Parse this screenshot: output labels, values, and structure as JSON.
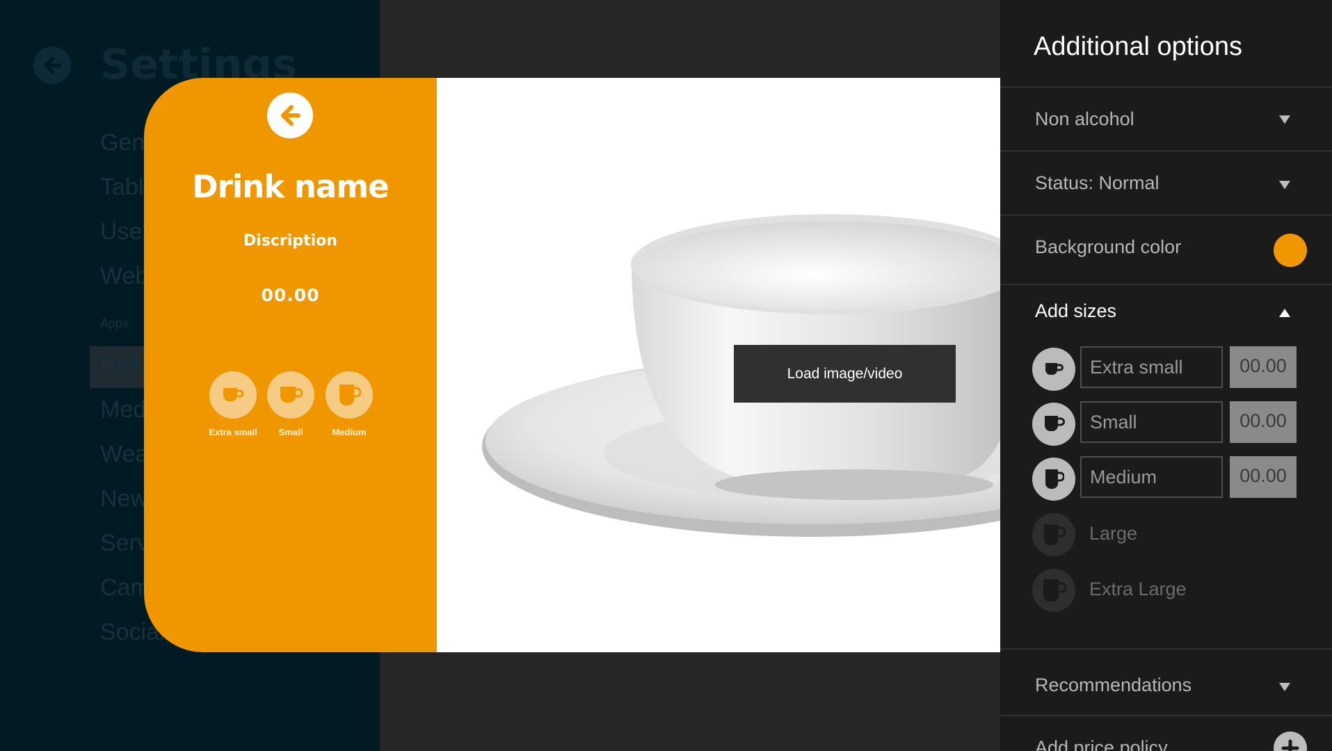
{
  "background": {
    "title": "Settings",
    "items": [
      "General",
      "Tables",
      "Users",
      "Web",
      "Restaurant",
      "Media",
      "Weather",
      "News",
      "Services",
      "Camera",
      "Social"
    ],
    "sub_label": "Apps",
    "active_item": "Restaurant"
  },
  "card": {
    "drink_name": "Drink name",
    "description": "Discription",
    "price": "00.00",
    "sizes": [
      {
        "label": "Extra small",
        "icon": "cup-extra-small-icon"
      },
      {
        "label": "Small",
        "icon": "cup-small-icon"
      },
      {
        "label": "Medium",
        "icon": "cup-medium-icon"
      }
    ],
    "load_button": "Load image/video",
    "accent_color": "#f09700"
  },
  "panel": {
    "title": "Additional options",
    "category": "Non alcohol",
    "status": "Status: Normal",
    "background_color_label": "Background color",
    "background_color": "#f09700",
    "add_sizes_label": "Add sizes",
    "sizes": [
      {
        "name": "Extra small",
        "price": "00.00",
        "enabled": true
      },
      {
        "name": "Small",
        "price": "00.00",
        "enabled": true
      },
      {
        "name": "Medium",
        "price": "00.00",
        "enabled": true
      },
      {
        "name": "Large",
        "price": "",
        "enabled": false
      },
      {
        "name": "Extra Large",
        "price": "",
        "enabled": false
      }
    ],
    "recommendations_label": "Recommendations",
    "price_policy_label": "Add price policy"
  }
}
